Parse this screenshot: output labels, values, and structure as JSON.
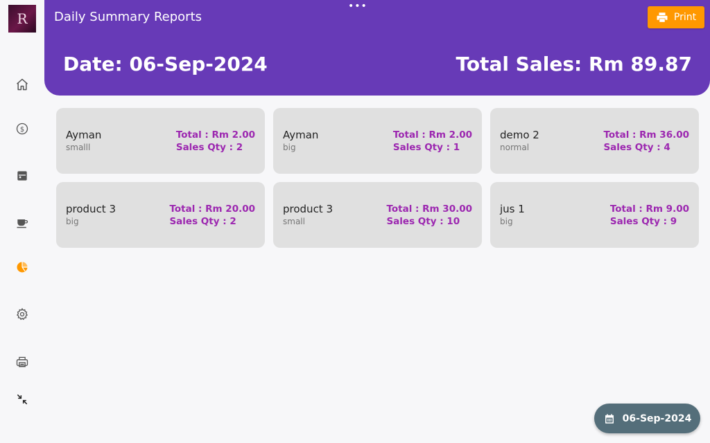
{
  "app": {
    "logo_letter": "R",
    "title": "Daily Summary Reports",
    "print_label": "Print",
    "date_heading": "Date: 06-Sep-2024",
    "total_sales_heading": "Total Sales: Rm 89.87",
    "date_chip": "06-Sep-2024"
  },
  "sidebar": {
    "items": [
      {
        "icon": "home-icon",
        "active": false
      },
      {
        "icon": "dollar-icon",
        "active": false
      },
      {
        "icon": "inventory-icon",
        "active": false
      },
      {
        "icon": "coffee-icon",
        "active": false
      },
      {
        "icon": "pie-chart-icon",
        "active": true
      },
      {
        "icon": "gear-icon",
        "active": false
      },
      {
        "icon": "printer-icon",
        "active": false
      },
      {
        "icon": "collapse-icon",
        "active": false
      }
    ]
  },
  "cards": [
    {
      "name": "Ayman",
      "variant": "smalll",
      "total": "Total : Rm 2.00",
      "qty": "Sales Qty : 2"
    },
    {
      "name": "Ayman",
      "variant": "big",
      "total": "Total : Rm 2.00",
      "qty": "Sales Qty : 1"
    },
    {
      "name": "demo 2",
      "variant": "normal",
      "total": "Total : Rm 36.00",
      "qty": "Sales Qty : 4"
    },
    {
      "name": "product 3",
      "variant": "big",
      "total": "Total : Rm 20.00",
      "qty": "Sales Qty : 2"
    },
    {
      "name": "product 3",
      "variant": "small",
      "total": "Total : Rm 30.00",
      "qty": "Sales Qty : 10"
    },
    {
      "name": "jus 1",
      "variant": "big",
      "total": "Total : Rm 9.00",
      "qty": "Sales Qty : 9"
    }
  ],
  "colors": {
    "header": "#673ab7",
    "print_button": "#ff9800",
    "accent_text": "#9c27b0",
    "active_icon": "#ff9800",
    "date_chip": "#546e7a"
  }
}
